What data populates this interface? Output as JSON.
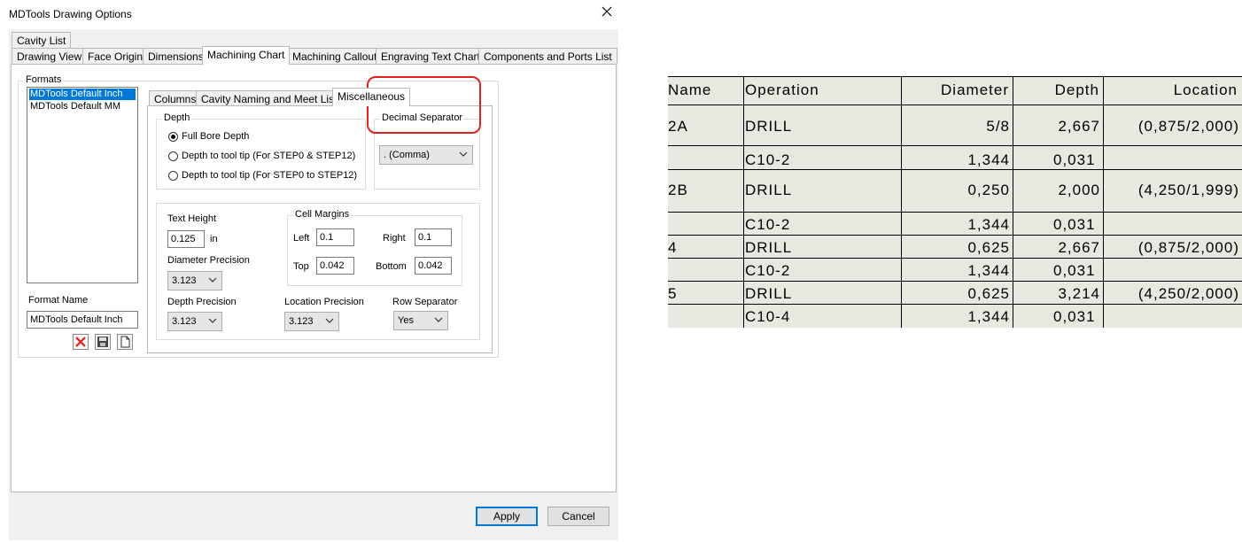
{
  "dialog": {
    "title": "MDTools Drawing Options",
    "close_glyph": "✕",
    "tabs_row1": [
      "Cavity List"
    ],
    "tabs_row2": [
      "Drawing View",
      "Face Origin",
      "Dimensions",
      "Machining Chart",
      "Machining Callout",
      "Engraving Text Chart",
      "Components and Ports List"
    ],
    "selected_tab": "Machining Chart",
    "formats": {
      "label": "Formats",
      "items": [
        "MDTools Default Inch",
        "MDTools Default MM"
      ],
      "selected": "MDTools Default Inch",
      "format_name_label": "Format Name",
      "format_name_value": "MDTools Default Inch"
    },
    "subtabs": [
      "Columns",
      "Cavity Naming and Meet List",
      "Miscellaneous"
    ],
    "selected_subtab": "Miscellaneous",
    "depth": {
      "label": "Depth",
      "options": [
        "Full Bore Depth",
        "Depth to tool tip (For STEP0 & STEP12)",
        "Depth to tool tip (For STEP0 to STEP12)"
      ],
      "selected": "Full Bore Depth"
    },
    "decimal_separator": {
      "label": "Decimal Separator",
      "value": ". (Comma)"
    },
    "text_height": {
      "label": "Text Height",
      "value": "0.125",
      "unit": "in"
    },
    "diameter_precision": {
      "label": "Diameter Precision",
      "value": "3.123"
    },
    "depth_precision": {
      "label": "Depth Precision",
      "value": "3.123"
    },
    "location_precision": {
      "label": "Location Precision",
      "value": "3.123"
    },
    "row_separator": {
      "label": "Row Separator",
      "value": "Yes"
    },
    "cell_margins": {
      "label": "Cell Margins",
      "left_label": "Left",
      "left": "0.1",
      "right_label": "Right",
      "right": "0.1",
      "top_label": "Top",
      "top": "0.042",
      "bottom_label": "Bottom",
      "bottom": "0.042"
    },
    "buttons": {
      "apply": "Apply",
      "cancel": "Cancel"
    },
    "colors": {
      "highlight": "#e0221d",
      "selection": "#0078d7",
      "dialog_bg": "#f0f0f0"
    }
  },
  "chart": {
    "headers": [
      "Name",
      "Operation",
      "Diameter",
      "Depth",
      "Location"
    ],
    "rows": [
      {
        "name": "2A",
        "operation": "DRILL",
        "diameter": "5/8",
        "depth": "2,667",
        "location": "(0,875/2,000)"
      },
      {
        "name": "",
        "operation": "C10-2",
        "diameter": "1,344",
        "depth": "0,031",
        "location": ""
      },
      {
        "name": "2B",
        "operation": "DRILL",
        "diameter": "0,250",
        "depth": "2,000",
        "location": "(4,250/1,999)"
      },
      {
        "name": "",
        "operation": "C10-2",
        "diameter": "1,344",
        "depth": "0,031",
        "location": ""
      },
      {
        "name": "4",
        "operation": "DRILL",
        "diameter": "0,625",
        "depth": "2,667",
        "location": "(0,875/2,000)"
      },
      {
        "name": "",
        "operation": "C10-2",
        "diameter": "1,344",
        "depth": "0,031",
        "location": ""
      },
      {
        "name": "5",
        "operation": "DRILL",
        "diameter": "0,625",
        "depth": "3,214",
        "location": "(4,250/2,000)"
      },
      {
        "name": "",
        "operation": "C10-4",
        "diameter": "1,344",
        "depth": "0,031",
        "location": ""
      }
    ],
    "background": "#e8e8e0"
  }
}
